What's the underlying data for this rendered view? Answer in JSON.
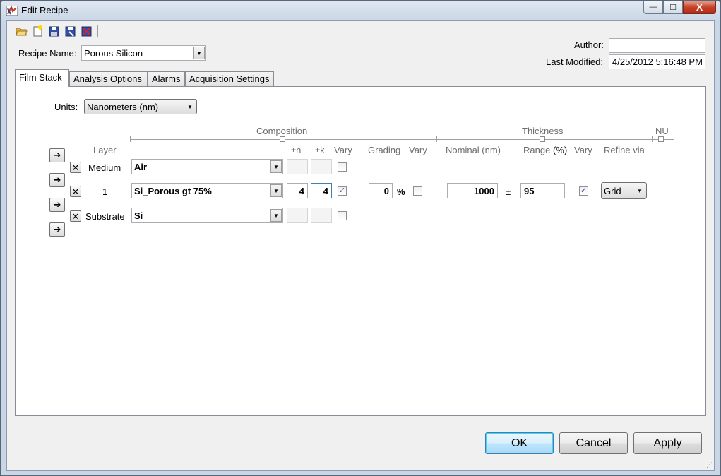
{
  "window": {
    "title": "Edit Recipe",
    "controls": {
      "minimize": "—",
      "maximize": "☐",
      "close": "X"
    }
  },
  "toolbar": {
    "icons": [
      "open-folder-icon",
      "new-recipe-icon",
      "save-icon",
      "save-as-icon",
      "delete-recipe-icon"
    ]
  },
  "recipe": {
    "name_label": "Recipe Name:",
    "name_value": "Porous Silicon",
    "author_label": "Author:",
    "author_value": "",
    "last_modified_label": "Last Modified:",
    "last_modified_value": "4/25/2012 5:16:48 PM"
  },
  "tabs": [
    {
      "label": "Film Stack",
      "active": true
    },
    {
      "label": "Analysis Options",
      "active": false
    },
    {
      "label": "Alarms",
      "active": false
    },
    {
      "label": "Acquisition Settings",
      "active": false
    }
  ],
  "film_stack": {
    "units_label": "Units:",
    "units_value": "Nanometers (nm)",
    "groups": {
      "composition": "Composition",
      "thickness": "Thickness",
      "nu": "NU"
    },
    "columns": {
      "layer": "Layer",
      "n": "±n",
      "k": "±k",
      "vary": "Vary",
      "grading": "Grading",
      "grading_vary": "Vary",
      "nominal": "Nominal (nm)",
      "range": "Range",
      "range_unit": "(%)",
      "thickness_vary": "Vary",
      "refine_via": "Refine via"
    },
    "rows": [
      {
        "layer": "Medium",
        "material": "Air",
        "n": "",
        "k": "",
        "vary": false
      },
      {
        "layer": "1",
        "material": "Si_Porous gt 75%",
        "n": "4",
        "k": "4",
        "vary": true,
        "grading": "0",
        "grading_unit": "%",
        "grading_vary": false,
        "nominal": "1000",
        "pm": "±",
        "range": "95",
        "thickness_vary": true,
        "refine_via": "Grid"
      },
      {
        "layer": "Substrate",
        "material": "Si",
        "n": "",
        "k": "",
        "vary": false
      }
    ]
  },
  "buttons": {
    "ok": "OK",
    "cancel": "Cancel",
    "apply": "Apply"
  },
  "colors": {
    "accent": "#3c7fb1",
    "check": "#2a4b8d",
    "close": "#c7432a"
  }
}
